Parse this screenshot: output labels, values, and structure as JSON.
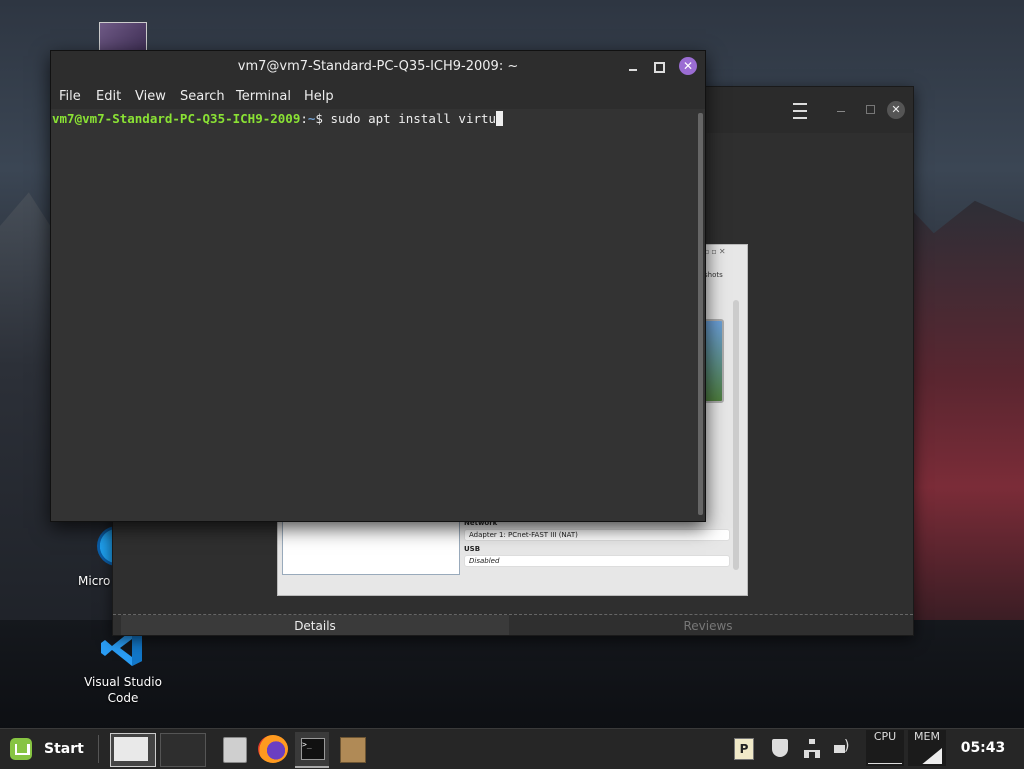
{
  "desktop": {
    "icons": [
      {
        "label": "Micro"
      },
      {
        "label": "Visual Studio Code"
      }
    ]
  },
  "background_window": {
    "tabs": [
      {
        "label": "Details"
      },
      {
        "label": "Reviews"
      }
    ],
    "screenshot": {
      "snapshots_label": "shots",
      "network_header": "Network",
      "network_value": "Adapter 1: PCnet-FAST III (NAT)",
      "usb_header": "USB",
      "usb_value": "Disabled"
    }
  },
  "terminal": {
    "title": "vm7@vm7-Standard-PC-Q35-ICH9-2009: ~",
    "menu": [
      "File",
      "Edit",
      "View",
      "Search",
      "Terminal",
      "Help"
    ],
    "prompt_user": "vm7@vm7-Standard-PC-Q35-ICH9-2009",
    "prompt_sep": ":",
    "prompt_path": "~",
    "prompt_symbol": "$ ",
    "command": "sudo apt install virtu"
  },
  "taskbar": {
    "start_label": "Start",
    "tray_p_label": "P",
    "cpu_label": "CPU",
    "mem_label": "MEM",
    "clock": "05:43"
  }
}
